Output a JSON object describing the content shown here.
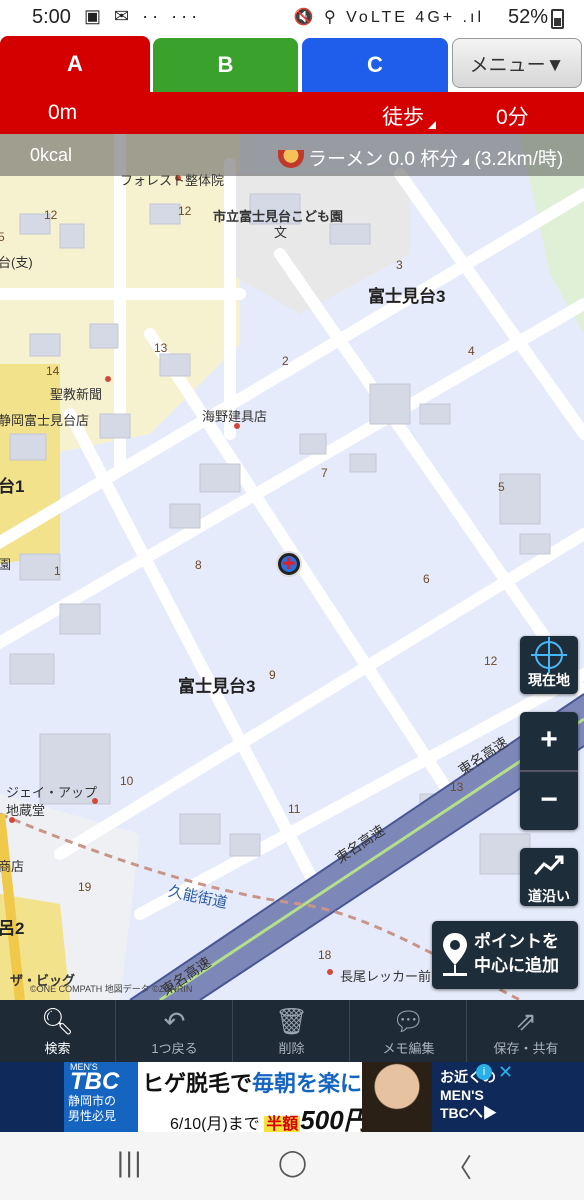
{
  "status_bar": {
    "time": "5:00",
    "left_icons": "▣ ✉ ·· ···",
    "right_icons": "🔇 ⚲ VoLTE 4G+ .ıl",
    "battery": "52%"
  },
  "tabs": [
    {
      "label": "A"
    },
    {
      "label": "B"
    },
    {
      "label": "C"
    }
  ],
  "menu_button": "メニュー▼",
  "route_bar": {
    "distance": "0m",
    "mode": "徒歩",
    "minutes": "0分"
  },
  "calorie_bar": {
    "kcal": "0kcal",
    "ramen": "ラーメン 0.0 杯分",
    "speed": "(3.2km/時)"
  },
  "map": {
    "labels": {
      "forest": "フォレスト整体院",
      "kodomoen": "市立富士見台こども園",
      "bun": "文",
      "area_top": "富士見台3",
      "area_bottom": "富士見台3",
      "seikyo": "聖教新聞",
      "shizuoka_store": "静岡富士見台店",
      "kaino": "海野建具店",
      "shi": "台(支)",
      "jay": "ジェイ・アップ",
      "jizo": "地蔵堂",
      "shoten": "商店",
      "hwy1": "東名高速",
      "hwy2": "東名高速",
      "hwy3": "東名高速",
      "kuno": "久能街道",
      "nagao": "長尾レッカー前",
      "big": "ザ・ビッグ",
      "copyright": "©ONE COMPATH 地図データ ©ZENRIN",
      "n12a": "12",
      "n12b": "12",
      "n12c": "12",
      "n13a": "13",
      "n13b": "13",
      "n14": "14",
      "n2": "2",
      "n3": "3",
      "n4": "4",
      "n5a": "5",
      "n5b": "5",
      "n6": "6",
      "n7": "7",
      "n8": "8",
      "n9": "9",
      "n10": "10",
      "n11": "11",
      "n1": "1",
      "n18": "18",
      "n19": "19",
      "edge1": "台1",
      "edge2": "呂2",
      "edgeen": "園"
    }
  },
  "map_buttons": {
    "current_location": "現在地",
    "zoom_in": "+",
    "zoom_out": "−",
    "along_road": "道沿い",
    "add_point_line1": "ポイントを",
    "add_point_line2": "中心に追加"
  },
  "toolbar": [
    {
      "label": "検索",
      "icon": "search-icon"
    },
    {
      "label": "1つ戻る",
      "icon": "undo-icon"
    },
    {
      "label": "削除",
      "icon": "trash-icon"
    },
    {
      "label": "メモ編集",
      "icon": "memo-icon"
    },
    {
      "label": "保存・共有",
      "icon": "share-icon"
    }
  ],
  "ad": {
    "brand_small": "MEN'S",
    "brand": "TBC",
    "city": "静岡市の",
    "target": "男性必見",
    "headline_pre": "ヒゲ脱毛で",
    "headline_hi": "毎朝を楽に",
    "date": "6/10(月)まで",
    "half": "半額",
    "price": "500円",
    "right1": "お近くの",
    "right2": "MEN'S",
    "right3": "TBCへ▶"
  },
  "nav": {
    "recent": "|||",
    "home": "◯",
    "back": "〈"
  },
  "colors": {
    "tab_a": "#d40000",
    "tab_b": "#3aa12c",
    "tab_c": "#1f5eea",
    "map_area": "#e6ebfb",
    "toolbar": "#1e2a36"
  }
}
